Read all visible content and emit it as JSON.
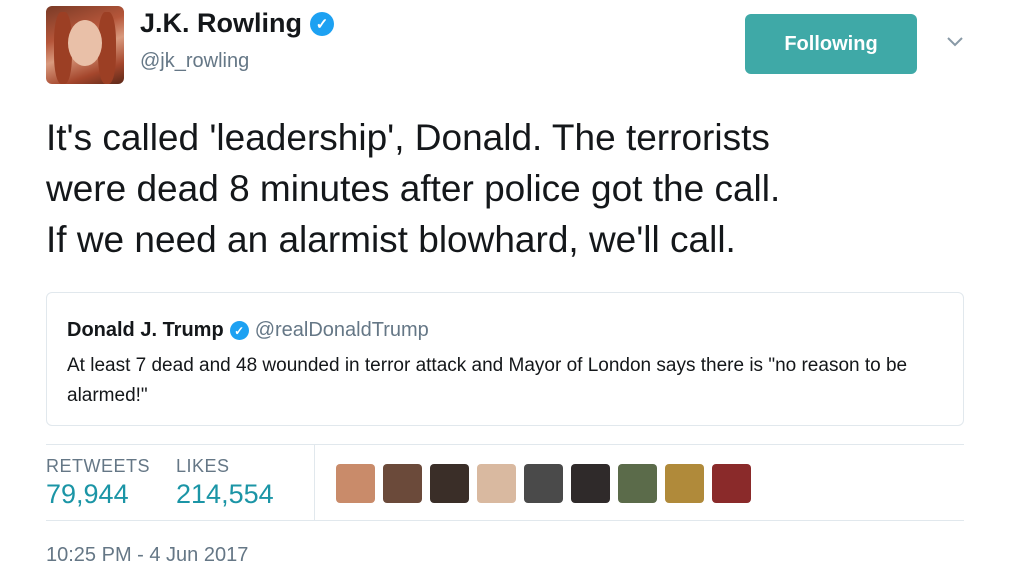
{
  "author": {
    "name": "J.K. Rowling",
    "handle": "@jk_rowling",
    "avatar_icon": "profile-photo"
  },
  "follow_button": {
    "label": "Following"
  },
  "menu_icon": "chevron-down-icon",
  "tweet": {
    "text": "It's called 'leadership', Donald. The terrorists\nwere dead 8 minutes after police got the call.\nIf we need an alarmist blowhard, we'll call."
  },
  "quoted_tweet": {
    "name": "Donald J. Trump",
    "handle": "@realDonaldTrump",
    "text": "At least 7 dead and 48 wounded in terror attack and Mayor of London says there is \"no reason to be alarmed!\""
  },
  "stats": {
    "retweets_label": "RETWEETS",
    "retweets_value": "79,944",
    "likes_label": "LIKES",
    "likes_value": "214,554"
  },
  "likers": [
    {
      "color": "#c98b6a"
    },
    {
      "color": "#6b4a3a"
    },
    {
      "color": "#3a2e28"
    },
    {
      "color": "#d9b9a0"
    },
    {
      "color": "#4a4a4a"
    },
    {
      "color": "#2f2a2a"
    },
    {
      "color": "#5b6b4a"
    },
    {
      "color": "#b08a3a"
    },
    {
      "color": "#8a2a2a"
    }
  ],
  "timestamp": "10:25 PM - 4 Jun 2017",
  "colors": {
    "follow_button": "#3fa9a7",
    "verified": "#1da1f2",
    "stat_value": "#1b95a6",
    "secondary_text": "#657786"
  }
}
